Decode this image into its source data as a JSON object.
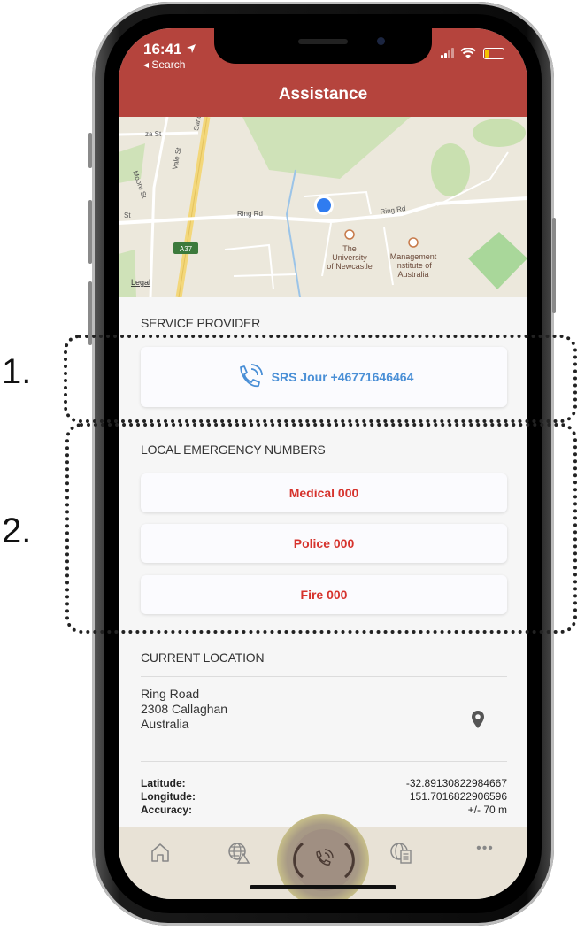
{
  "status_bar": {
    "time": "16:41",
    "back_label": "Search"
  },
  "header": {
    "title": "Assistance"
  },
  "map": {
    "streets": [
      "Sandg",
      "Vale St",
      "Moore St",
      "Ring Rd",
      "Ring Rd",
      "St",
      "za St"
    ],
    "route_badge": "A37",
    "poi_1": [
      "The",
      "University",
      "of Newcastle"
    ],
    "poi_2": [
      "Management",
      "Institute of",
      "Australia"
    ],
    "legal": "Legal"
  },
  "service_provider": {
    "label": "SERVICE PROVIDER",
    "button": "SRS Jour +46771646464"
  },
  "local_emergency": {
    "label": "LOCAL EMERGENCY NUMBERS",
    "buttons": [
      "Medical 000",
      "Police 000",
      "Fire 000"
    ]
  },
  "current_location": {
    "label": "CURRENT LOCATION",
    "address": [
      "Ring Road",
      "2308 Callaghan",
      "Australia"
    ],
    "coords": [
      {
        "key": "Latitude:",
        "value": "-32.89130822984667"
      },
      {
        "key": "Longitude:",
        "value": "151.7016822906596"
      },
      {
        "key": "Accuracy:",
        "value": "+/- 70 m"
      }
    ]
  },
  "tabbar": {
    "more": "•••"
  },
  "annotations": {
    "one": "1.",
    "two": "2."
  },
  "colors": {
    "header": "#b5443d",
    "provider_text": "#4a8fd6",
    "emergency_text": "#d6332d",
    "user_dot": "#2f7cf0"
  }
}
